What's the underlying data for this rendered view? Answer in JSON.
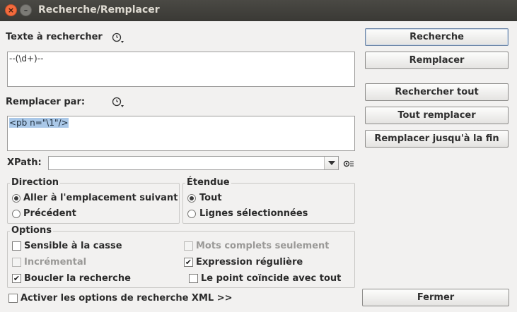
{
  "window": {
    "title": "Recherche/Remplacer",
    "close_glyph": "×",
    "minimize_glyph": "–"
  },
  "search": {
    "label": "Texte à rechercher",
    "value": "--(\\d+)--"
  },
  "replace": {
    "label": "Remplacer par:",
    "value": "<pb n=\"\\1\"/>"
  },
  "xpath": {
    "label": "XPath:",
    "value": ""
  },
  "direction": {
    "title": "Direction",
    "options": [
      {
        "label": "Aller à l'emplacement suivant",
        "selected": true
      },
      {
        "label": "Précédent",
        "selected": false
      }
    ]
  },
  "scope": {
    "title": "Étendue",
    "options": [
      {
        "label": "Tout",
        "selected": true
      },
      {
        "label": "Lignes sélectionnées",
        "selected": false
      }
    ]
  },
  "options": {
    "title": "Options",
    "items": [
      {
        "label": "Sensible à la casse",
        "checked": false,
        "enabled": true
      },
      {
        "label": "Mots complets seulement",
        "checked": false,
        "enabled": false
      },
      {
        "label": "Incrémental",
        "checked": false,
        "enabled": false
      },
      {
        "label": "Expression régulière",
        "checked": true,
        "enabled": true
      },
      {
        "label": "Boucler la recherche",
        "checked": true,
        "enabled": true
      },
      {
        "label": "Le point coïncide avec tout",
        "checked": false,
        "enabled": true
      }
    ]
  },
  "xml_options": {
    "label": "Activer les options de recherche XML >>",
    "checked": false
  },
  "buttons": {
    "find": "Recherche",
    "replace": "Remplacer",
    "find_all": "Rechercher tout",
    "replace_all": "Tout remplacer",
    "replace_to_end": "Remplacer jusqu'à la fin",
    "close": "Fermer"
  },
  "icons": {
    "history": "history-dropdown-icon",
    "combo_arrow": "chevron-down-icon",
    "xpath_settings": "gear-settings-icon",
    "check_mark": "✔"
  },
  "colors": {
    "titlebar": "#3c3b37",
    "close_button": "#f46b3d",
    "selection": "#aac8e8",
    "dialog_bg": "#f2f1f0"
  }
}
